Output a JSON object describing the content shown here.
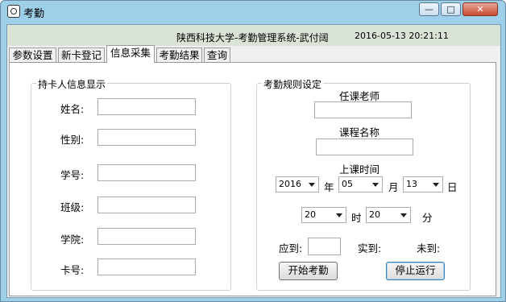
{
  "window": {
    "title": "考勤",
    "min_label": "—",
    "max_label": "□",
    "close_label": "✕"
  },
  "header": {
    "title": "陕西科技大学-考勤管理系统-武付阔",
    "datetime": "2016-05-13 20:21:11"
  },
  "tabs": [
    {
      "label": "参数设置"
    },
    {
      "label": "新卡登记"
    },
    {
      "label": "信息采集"
    },
    {
      "label": "考勤结果"
    },
    {
      "label": "查询"
    }
  ],
  "active_tab": "信息采集",
  "card_info": {
    "legend": "持卡人信息显示",
    "name_label": "姓名:",
    "gender_label": "性别:",
    "student_id_label": "学号:",
    "class_label": "班级:",
    "college_label": "学院:",
    "card_no_label": "卡号:"
  },
  "rules": {
    "legend": "考勤规则设定",
    "teacher_label": "任课老师",
    "course_label": "课程名称",
    "time_label": "上课时间",
    "year": "2016",
    "year_unit": "年",
    "month": "05",
    "month_unit": "月",
    "day": "13",
    "day_unit": "日",
    "hour": "20",
    "hour_unit": "时",
    "minute": "20",
    "minute_unit": "分",
    "expected_label": "应到:",
    "present_label": "实到:",
    "absent_label": "未到:",
    "start_button": "开始考勤",
    "stop_button": "停止运行"
  }
}
